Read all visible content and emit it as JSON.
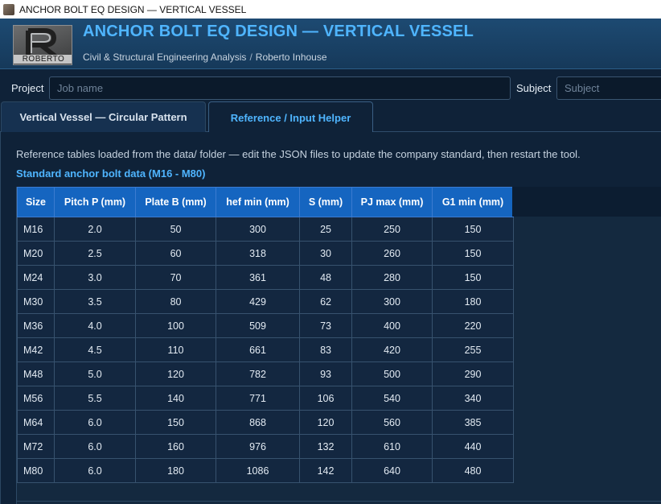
{
  "window": {
    "title": "ANCHOR BOLT EQ DESIGN — VERTICAL VESSEL"
  },
  "header": {
    "logo_text": "ROBERTO",
    "title": "ANCHOR BOLT EQ DESIGN — VERTICAL VESSEL",
    "subtitle_left": "Civil & Structural Engineering Analysis",
    "subtitle_sep": "/",
    "subtitle_right": "Roberto Inhouse"
  },
  "meta": {
    "project_label": "Project",
    "project_placeholder": "Job name",
    "subject_label": "Subject",
    "subject_placeholder": "Subject"
  },
  "tabs": [
    {
      "label": "Vertical Vessel — Circular Pattern",
      "active": false
    },
    {
      "label": "Reference / Input Helper",
      "active": true
    }
  ],
  "panel": {
    "info": "Reference tables loaded from the data/ folder — edit the JSON files to update the company standard, then restart the tool.",
    "section_title": "Standard anchor bolt data (M16 - M80)"
  },
  "table": {
    "columns": [
      "Size",
      "Pitch P (mm)",
      "Plate B (mm)",
      "hef min (mm)",
      "S (mm)",
      "PJ max (mm)",
      "G1 min (mm)"
    ],
    "rows": [
      [
        "M16",
        "2.0",
        "50",
        "300",
        "25",
        "250",
        "150"
      ],
      [
        "M20",
        "2.5",
        "60",
        "318",
        "30",
        "260",
        "150"
      ],
      [
        "M24",
        "3.0",
        "70",
        "361",
        "48",
        "280",
        "150"
      ],
      [
        "M30",
        "3.5",
        "80",
        "429",
        "62",
        "300",
        "180"
      ],
      [
        "M36",
        "4.0",
        "100",
        "509",
        "73",
        "400",
        "220"
      ],
      [
        "M42",
        "4.5",
        "110",
        "661",
        "83",
        "420",
        "255"
      ],
      [
        "M48",
        "5.0",
        "120",
        "782",
        "93",
        "500",
        "290"
      ],
      [
        "M56",
        "5.5",
        "140",
        "771",
        "106",
        "540",
        "340"
      ],
      [
        "M64",
        "6.0",
        "150",
        "868",
        "120",
        "560",
        "385"
      ],
      [
        "M72",
        "6.0",
        "160",
        "976",
        "132",
        "610",
        "440"
      ],
      [
        "M80",
        "6.0",
        "180",
        "1086",
        "142",
        "640",
        "480"
      ]
    ]
  },
  "colors": {
    "accent": "#4fb5ff",
    "header_bg": "#1565c0",
    "page_bg": "#0f2238"
  }
}
